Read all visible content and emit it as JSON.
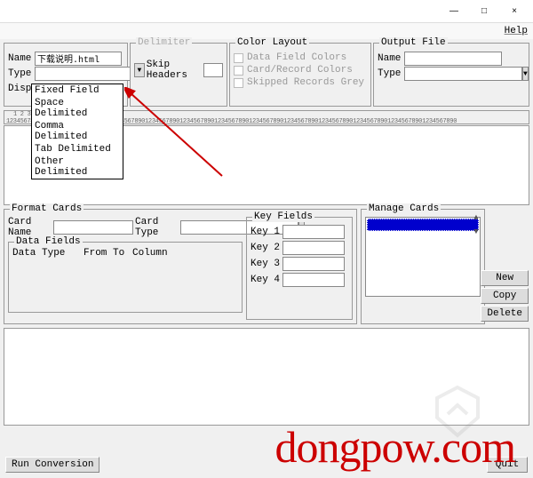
{
  "titlebar": {
    "min": "—",
    "max": "□",
    "close": "×"
  },
  "menubar": {
    "help": "Help"
  },
  "input": {
    "name_label": "Name",
    "name_value": "下载说明.html",
    "type_label": "Type",
    "type_value": "",
    "disp_label": "Disp."
  },
  "dropdown": {
    "items": [
      "Fixed Field",
      "Space Delimited",
      "Comma Delimited",
      "Tab Delimited",
      "Other Delimited"
    ]
  },
  "delimiter": {
    "legend": "Delimiter",
    "skip_label": "Skip Headers",
    "skip_value": ""
  },
  "color_layout": {
    "legend": "Color Layout",
    "opt1": "Data Field Colors",
    "opt2": "Card/Record Colors",
    "opt3": "Skipped Records Grey"
  },
  "output_file": {
    "legend": "Output File",
    "name_label": "Name",
    "name_value": "",
    "type_label": "Type",
    "type_value": ""
  },
  "ruler": {
    "nums": "1       2       3       4       5       6       7       8       9       10      11      12",
    "ticks": "1234567890123456789012345678901234567890123456789012345678901234567890123456789012345678901234567890123456789012345678901234567890"
  },
  "format_cards": {
    "legend": "Format Cards",
    "card_name_label": "Card Name",
    "card_name_value": "",
    "card_type_label": "Card Type",
    "card_type_value": "",
    "data_fields_legend": "Data Fields",
    "df_col1": "Data Type",
    "df_col2": "From To",
    "df_col3": "Column",
    "key_fields_legend": "Key Fields",
    "key1": "Key 1",
    "key2": "Key 2",
    "key3": "Key 3",
    "key4": "Key 4"
  },
  "manage_cards": {
    "legend": "Manage Cards",
    "new": "New",
    "copy": "Copy",
    "delete": "Delete"
  },
  "bottom": {
    "run": "Run Conversion",
    "quit": "Quit"
  },
  "watermark": "dongpow.com"
}
